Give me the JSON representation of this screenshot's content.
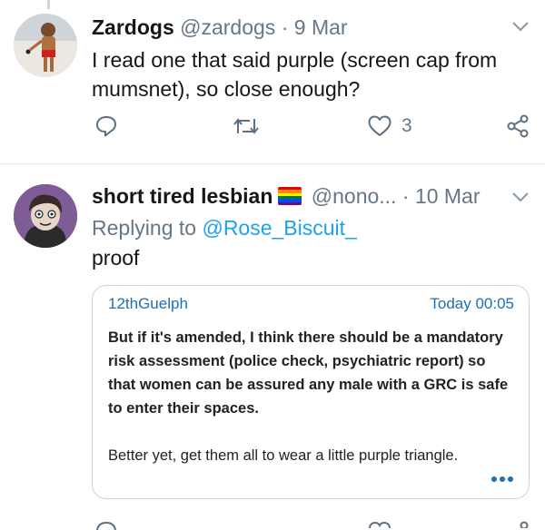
{
  "tweet1": {
    "display_name": "Zardogs",
    "handle": "@zardogs",
    "separator": "·",
    "date": "9 Mar",
    "text_line1": "I read one that said purple (screen cap from",
    "text_line2": "mumsnet), so close enough?",
    "like_count": "3"
  },
  "tweet2": {
    "display_name": "short tired lesbian",
    "handle": "@nono...",
    "separator": "·",
    "date": "10 Mar",
    "replying_prefix": "Replying to",
    "replying_handle": "@Rose_Biscuit_",
    "text": "proof",
    "card": {
      "username": "12thGuelph",
      "timestamp": "Today 00:05",
      "message_bold": "But if it's amended, I think there should be a mandatory risk assessment (police check, psychiatric report) so that women can be assured any male with a GRC is safe to enter their spaces.",
      "message": "Better yet, get them all to wear a little purple triangle."
    }
  },
  "colors": {
    "accent_blue": "#1da1f2",
    "muted_gray": "#657786",
    "card_link_blue": "#1f6fb2",
    "pride_flag": [
      "#e40303",
      "#ff8c00",
      "#ffed00",
      "#008026",
      "#004dff",
      "#750787"
    ]
  },
  "icons": {
    "reply": "reply-icon",
    "retweet": "retweet-icon",
    "like": "heart-icon",
    "share": "share-icon",
    "caret": "chevron-down-icon",
    "more": "more-dots-icon"
  }
}
